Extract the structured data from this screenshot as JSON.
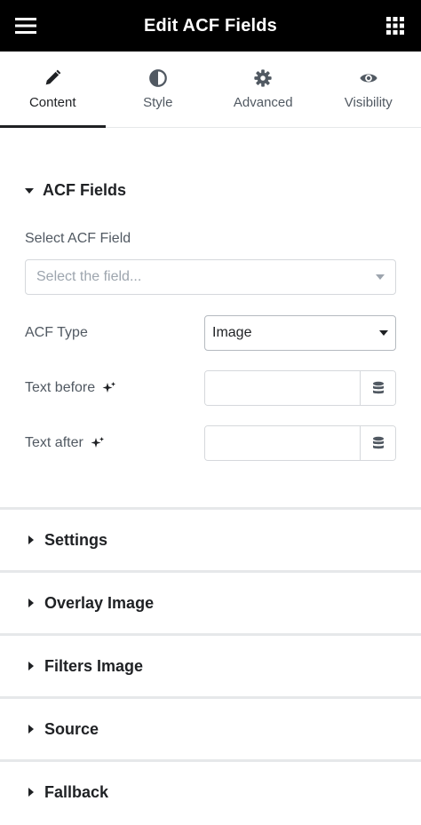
{
  "header": {
    "menu_icon": "hamburger-icon",
    "title": "Edit ACF Fields",
    "apps_icon": "grid-icon"
  },
  "tabs": [
    {
      "label": "Content",
      "icon": "pencil-icon",
      "active": true
    },
    {
      "label": "Style",
      "icon": "half-circle-icon",
      "active": false
    },
    {
      "label": "Advanced",
      "icon": "gear-icon",
      "active": false
    },
    {
      "label": "Visibility",
      "icon": "eye-icon",
      "active": false
    }
  ],
  "acf_section": {
    "title": "ACF Fields",
    "select_field_label": "Select ACF Field",
    "select_field_placeholder": "Select the field...",
    "acf_type_label": "ACF Type",
    "acf_type_value": "Image",
    "text_before_label": "Text before",
    "text_before_value": "",
    "text_after_label": "Text after",
    "text_after_value": "",
    "ai_icon": "sparkle-icon",
    "dynamic_icon": "database-icon"
  },
  "collapsed_sections": [
    {
      "label": "Settings"
    },
    {
      "label": "Overlay Image"
    },
    {
      "label": "Filters Image"
    },
    {
      "label": "Source"
    },
    {
      "label": "Fallback"
    }
  ],
  "colors": {
    "header_bg": "#000000",
    "text_primary": "#1f2124",
    "text_secondary": "#515962",
    "border": "#d5d8dc"
  }
}
